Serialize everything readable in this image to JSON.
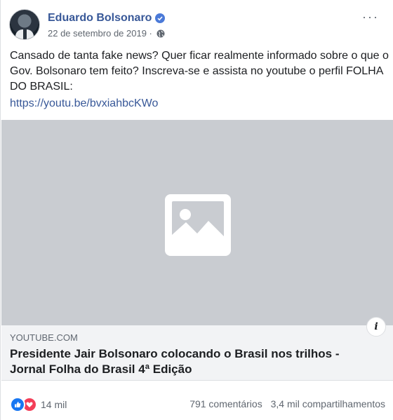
{
  "post": {
    "author": "Eduardo Bolsonaro",
    "date": "22 de setembro de 2019",
    "more_label": "···",
    "text": "Cansado de tanta fake news? Quer ficar realmente informado sobre o que o Gov. Bolsonaro tem feito? Inscreva-se e assista no youtube o perfil FOLHA DO BRASIL:",
    "link": "https://youtu.be/bvxiahbcKWo"
  },
  "link_card": {
    "domain": "YOUTUBE.COM",
    "title": "Presidente Jair Bolsonaro colocando o Brasil nos trilhos - Jornal Folha do Brasil 4ª Edição",
    "info_label": "i"
  },
  "footer": {
    "reaction_count": "14 mil",
    "comments": "791 comentários",
    "shares": "3,4 mil compartilhamentos"
  },
  "icons": [
    "verified-icon",
    "globe-icon",
    "image-placeholder-icon",
    "info-icon",
    "like-icon",
    "love-icon"
  ],
  "colors": {
    "link": "#385898",
    "like": "#1877f2",
    "love": "#f33e58",
    "media_placeholder": "#c9ccd1"
  }
}
